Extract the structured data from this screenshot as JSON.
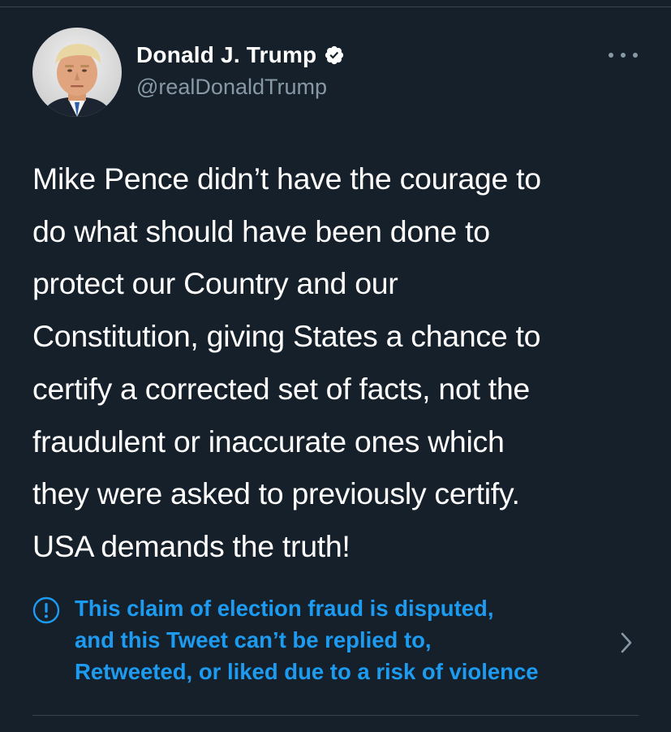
{
  "author": {
    "display_name": "Donald J. Trump",
    "handle": "@realDonaldTrump",
    "verified": true,
    "avatar_icon": "profile-photo"
  },
  "menu": {
    "icon": "more-options-icon"
  },
  "tweet": {
    "text": "Mike Pence didn’t have the courage to\ndo what should have been done to\nprotect our Country and our\nConstitution, giving States a chance to\ncertify a corrected set of facts, not the\nfraudulent or inaccurate ones which\nthey were asked to previously certify.\nUSA demands the truth!"
  },
  "notice": {
    "icon": "exclamation-circle-icon",
    "text": "This claim of election fraud is disputed,\nand this Tweet can’t be replied to,\nRetweeted, or liked due to a risk of violence",
    "chevron_icon": "chevron-right-icon"
  },
  "colors": {
    "background": "#15202b",
    "text_primary": "#ffffff",
    "text_secondary": "#8899a6",
    "accent": "#1d9bf0",
    "divider": "#38444d"
  }
}
